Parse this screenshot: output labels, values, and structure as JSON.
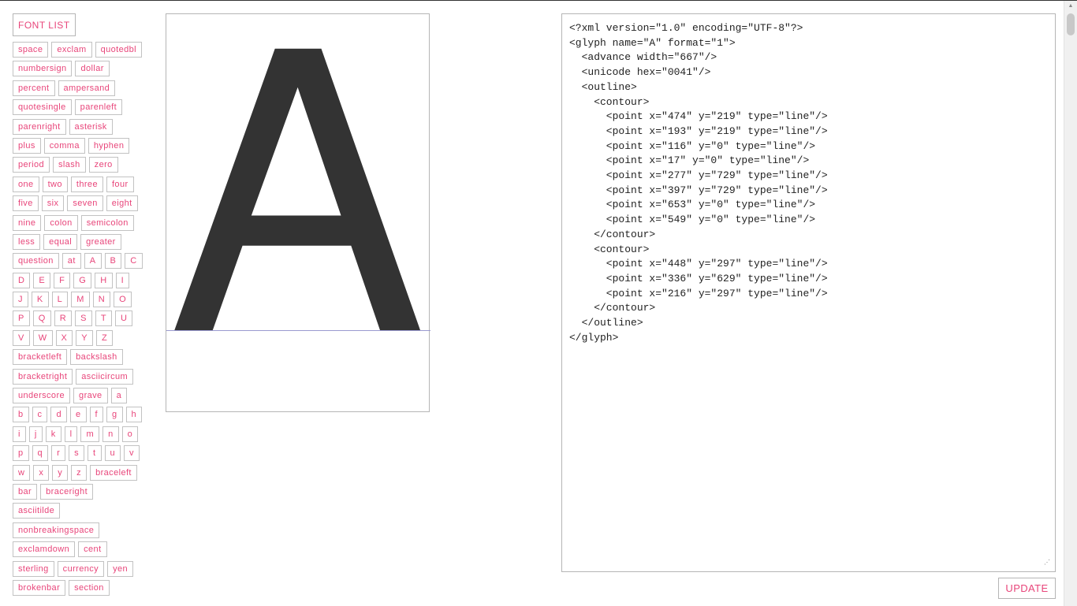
{
  "sidebar": {
    "font_list_label": "FONT LIST",
    "glyphs": [
      "space",
      "exclam",
      "quotedbl",
      "numbersign",
      "dollar",
      "percent",
      "ampersand",
      "quotesingle",
      "parenleft",
      "parenright",
      "asterisk",
      "plus",
      "comma",
      "hyphen",
      "period",
      "slash",
      "zero",
      "one",
      "two",
      "three",
      "four",
      "five",
      "six",
      "seven",
      "eight",
      "nine",
      "colon",
      "semicolon",
      "less",
      "equal",
      "greater",
      "question",
      "at",
      "A",
      "B",
      "C",
      "D",
      "E",
      "F",
      "G",
      "H",
      "I",
      "J",
      "K",
      "L",
      "M",
      "N",
      "O",
      "P",
      "Q",
      "R",
      "S",
      "T",
      "U",
      "V",
      "W",
      "X",
      "Y",
      "Z",
      "bracketleft",
      "backslash",
      "bracketright",
      "asciicircum",
      "underscore",
      "grave",
      "a",
      "b",
      "c",
      "d",
      "e",
      "f",
      "g",
      "h",
      "i",
      "j",
      "k",
      "l",
      "m",
      "n",
      "o",
      "p",
      "q",
      "r",
      "s",
      "t",
      "u",
      "v",
      "w",
      "x",
      "y",
      "z",
      "braceleft",
      "bar",
      "braceright",
      "asciitilde",
      "nonbreakingspace",
      "exclamdown",
      "cent",
      "sterling",
      "currency",
      "yen",
      "brokenbar",
      "section"
    ]
  },
  "preview": {
    "glyph_color": "#333333",
    "baseline_color": "#9a9ad0"
  },
  "editor": {
    "xml": "<?xml version=\"1.0\" encoding=\"UTF-8\"?>\n<glyph name=\"A\" format=\"1\">\n  <advance width=\"667\"/>\n  <unicode hex=\"0041\"/>\n  <outline>\n    <contour>\n      <point x=\"474\" y=\"219\" type=\"line\"/>\n      <point x=\"193\" y=\"219\" type=\"line\"/>\n      <point x=\"116\" y=\"0\" type=\"line\"/>\n      <point x=\"17\" y=\"0\" type=\"line\"/>\n      <point x=\"277\" y=\"729\" type=\"line\"/>\n      <point x=\"397\" y=\"729\" type=\"line\"/>\n      <point x=\"653\" y=\"0\" type=\"line\"/>\n      <point x=\"549\" y=\"0\" type=\"line\"/>\n    </contour>\n    <contour>\n      <point x=\"448\" y=\"297\" type=\"line\"/>\n      <point x=\"336\" y=\"629\" type=\"line\"/>\n      <point x=\"216\" y=\"297\" type=\"line\"/>\n    </contour>\n  </outline>\n</glyph>"
  },
  "update_label": "UPDATE",
  "accent_color": "#e8457a"
}
